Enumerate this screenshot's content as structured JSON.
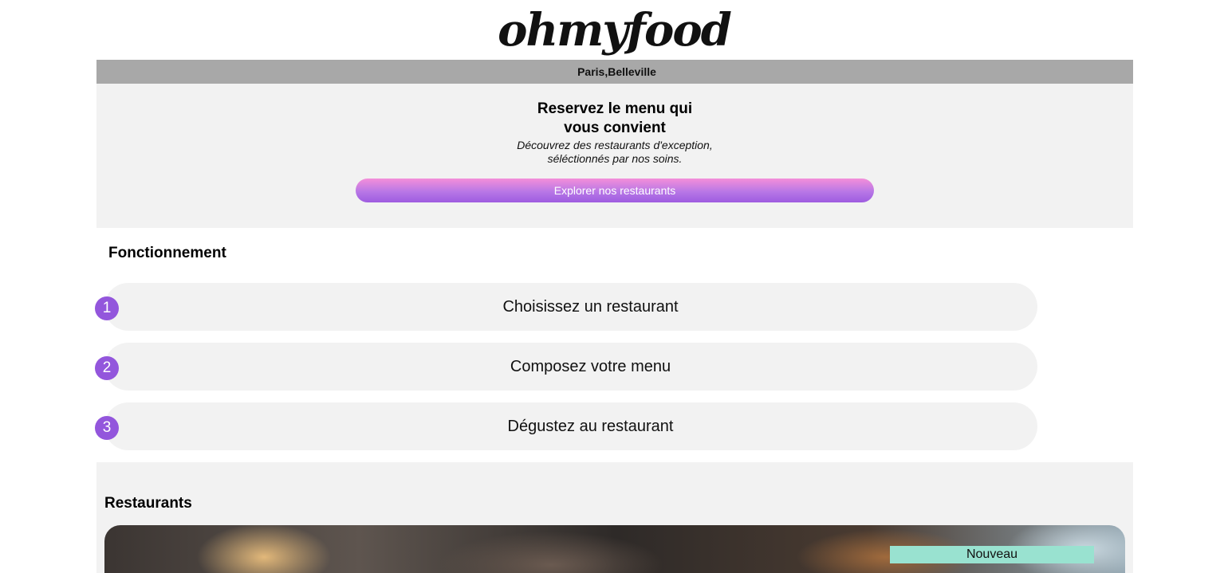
{
  "header": {
    "logo_text": "ohmyfood",
    "location": {
      "icon": "map-marker-icon",
      "icon_glyph": "",
      "text": "Paris,Belleville"
    }
  },
  "hero": {
    "title_line1": "Reservez le menu qui",
    "title_line2": "vous convient",
    "subtitle_line1": "Découvrez des restaurants d'exception,",
    "subtitle_line2": "séléctionnés par nos soins.",
    "cta_label": "Explorer nos restaurants"
  },
  "fonctionnement": {
    "title": "Fonctionnement",
    "steps": [
      {
        "number": "1",
        "icon": "mobile-phone-icon",
        "icon_glyph": "",
        "label": "Choisissez un restaurant"
      },
      {
        "number": "2",
        "icon": "list-icon",
        "icon_glyph": "",
        "label": "Composez votre menu"
      },
      {
        "number": "3",
        "icon": "store-icon",
        "icon_glyph": "",
        "label": "Dégustez au restaurant"
      }
    ]
  },
  "restaurants": {
    "title": "Restaurants",
    "cards": [
      {
        "badge": "Nouveau"
      }
    ]
  },
  "colors": {
    "location_bar": "#a8a8a8",
    "section_bg": "#f2f2f2",
    "accent_purple": "#9356dc",
    "button_gradient_top": "#f48fd9",
    "button_gradient_bottom": "#9e5ce0",
    "badge_bg": "#99e2d0"
  }
}
